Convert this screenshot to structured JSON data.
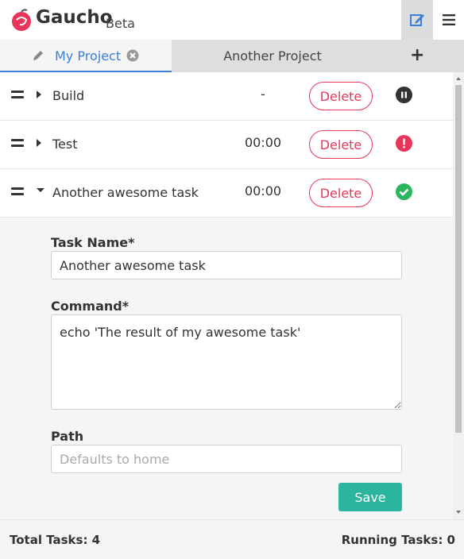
{
  "header": {
    "brand": "Gaucho",
    "badge": "Beta",
    "edit_icon": "edit-icon",
    "menu_icon": "hamburger-menu-icon",
    "accent": "#3c7fd6"
  },
  "tabs": [
    {
      "label": "My Project",
      "active": true,
      "icon": "pencil-icon",
      "close_icon": "close-circle-icon"
    },
    {
      "label": "Another Project",
      "active": false
    }
  ],
  "add_tab_label": "+",
  "tasks": [
    {
      "name": "Build",
      "time": "-",
      "delete_label": "Delete",
      "status": "paused",
      "expanded": false
    },
    {
      "name": "Test",
      "time": "00:00",
      "delete_label": "Delete",
      "status": "error",
      "expanded": false
    },
    {
      "name": "Another awesome task",
      "time": "00:00",
      "delete_label": "Delete",
      "status": "success",
      "expanded": true
    }
  ],
  "form": {
    "name_label": "Task Name*",
    "name_value": "Another awesome task",
    "command_label": "Command*",
    "command_value": "echo 'The result of my awesome task'",
    "path_label": "Path",
    "path_placeholder": "Defaults to home",
    "save_label": "Save"
  },
  "footer": {
    "total": "Total Tasks: 4",
    "running": "Running Tasks: 0"
  },
  "colors": {
    "delete": "#e8365a",
    "save": "#2bb59e",
    "error": "#e8365a",
    "success": "#2bb55e",
    "paused": "#333333"
  }
}
